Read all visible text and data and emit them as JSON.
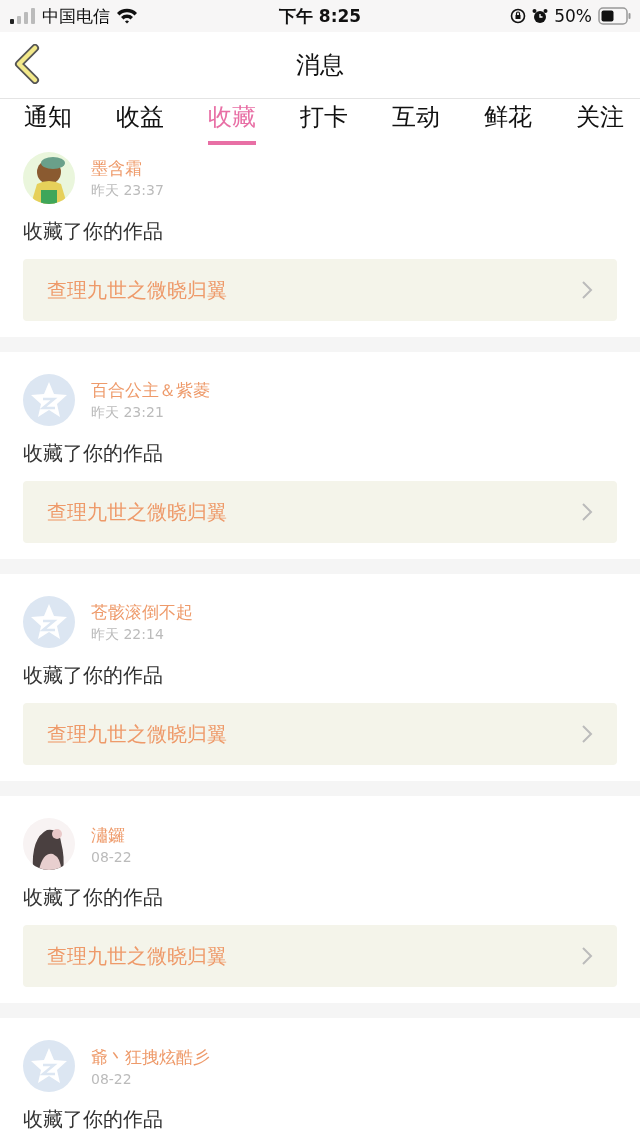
{
  "status_bar": {
    "carrier": "中国电信",
    "time": "下午 8:25",
    "battery": "50%"
  },
  "nav": {
    "title": "消息"
  },
  "tabs": [
    {
      "label": "通知",
      "selected": false
    },
    {
      "label": "收益",
      "selected": false
    },
    {
      "label": "收藏",
      "selected": true
    },
    {
      "label": "打卡",
      "selected": false
    },
    {
      "label": "互动",
      "selected": false
    },
    {
      "label": "鲜花",
      "selected": false
    },
    {
      "label": "关注",
      "selected": false
    }
  ],
  "messages": [
    {
      "kind": "picture",
      "name": "墨含霜",
      "time": "昨天 23:37",
      "action": "收藏了你的作品",
      "work": "查理九世之微晓归翼"
    },
    {
      "kind": "default",
      "name": "百合公主＆紫菱",
      "time": "昨天 23:21",
      "action": "收藏了你的作品",
      "work": "查理九世之微晓归翼"
    },
    {
      "kind": "default",
      "name": "苍骸滚倒不起",
      "time": "昨天 22:14",
      "action": "收藏了你的作品",
      "work": "查理九世之微晓归翼"
    },
    {
      "kind": "picture",
      "name": "潚鑼",
      "time": "08-22",
      "action": "收藏了你的作品",
      "work": "查理九世之微晓归翼"
    },
    {
      "kind": "default",
      "name": "爺丶狂拽炫酷彡",
      "time": "08-22",
      "action": "收藏了你的作品"
    }
  ]
}
